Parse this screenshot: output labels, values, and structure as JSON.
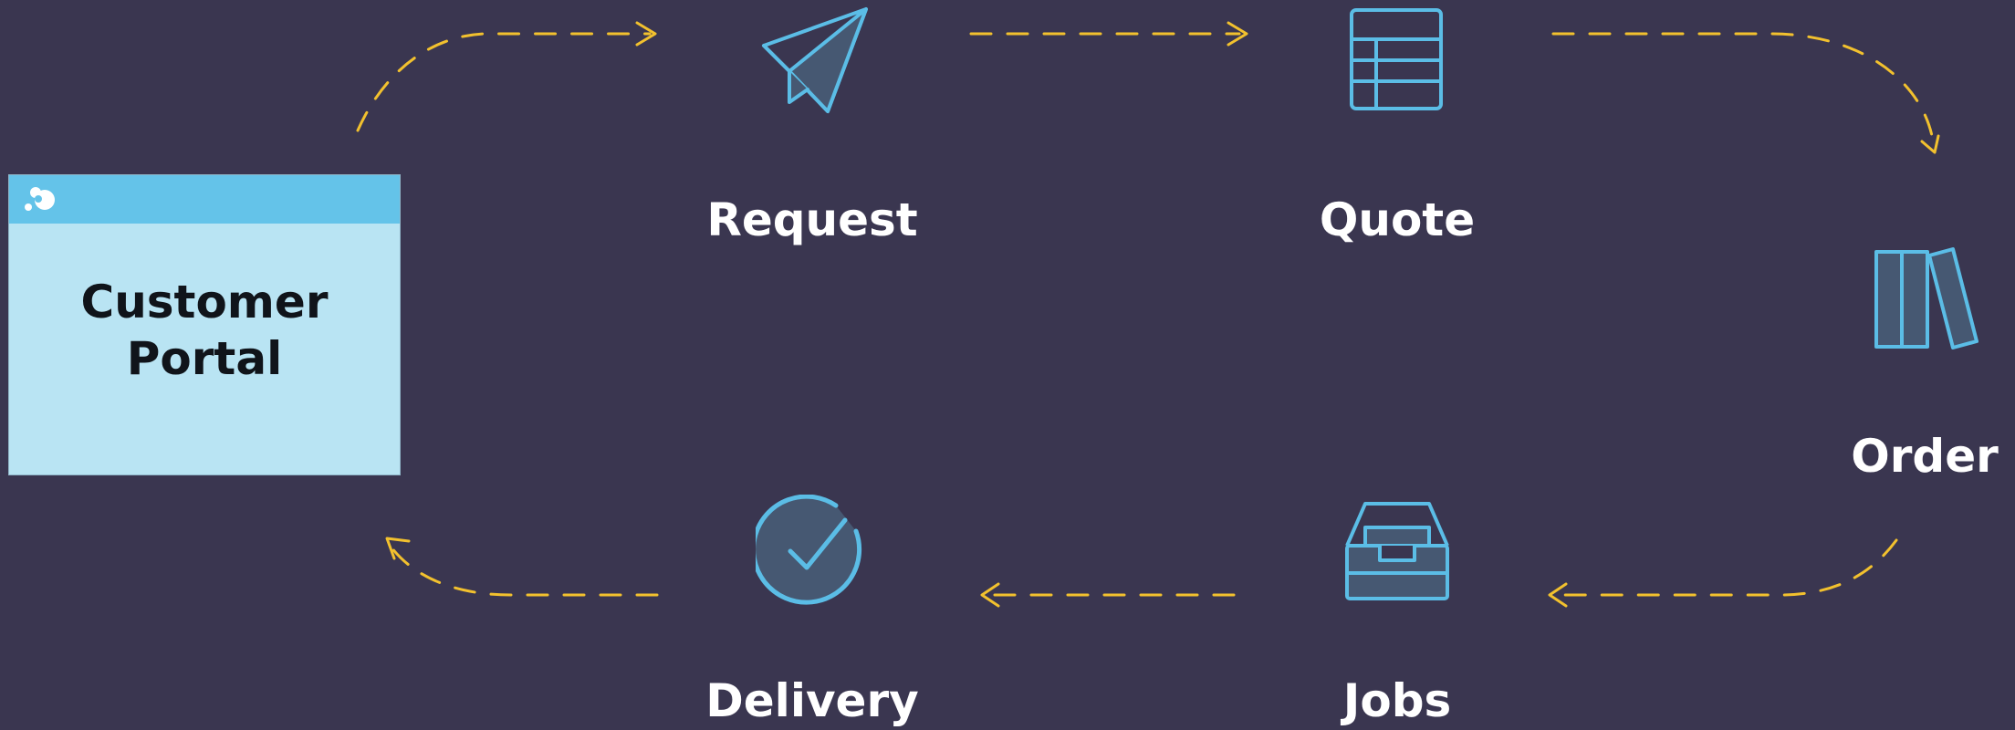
{
  "colors": {
    "background": "#3a3650",
    "icon_stroke": "#5bbde6",
    "icon_fill": "#465872",
    "connector": "#f2c12e",
    "portal_body": "#b9e4f3",
    "portal_header": "#64c3e9",
    "label_text": "#ffffff",
    "portal_text": "#10141a"
  },
  "portal": {
    "title": "Customer\nPortal",
    "logo_icon": "bubbles-logo-icon"
  },
  "nodes": [
    {
      "id": "request",
      "label": "Request",
      "icon": "paper-plane-icon"
    },
    {
      "id": "quote",
      "label": "Quote",
      "icon": "table-grid-icon"
    },
    {
      "id": "order",
      "label": "Order",
      "icon": "binders-icon"
    },
    {
      "id": "jobs",
      "label": "Jobs",
      "icon": "inbox-tray-icon"
    },
    {
      "id": "delivery",
      "label": "Delivery",
      "icon": "check-circle-icon"
    }
  ],
  "flow": [
    {
      "from": "portal",
      "to": "request"
    },
    {
      "from": "request",
      "to": "quote"
    },
    {
      "from": "quote",
      "to": "order"
    },
    {
      "from": "order",
      "to": "jobs"
    },
    {
      "from": "jobs",
      "to": "delivery"
    },
    {
      "from": "delivery",
      "to": "portal"
    }
  ]
}
